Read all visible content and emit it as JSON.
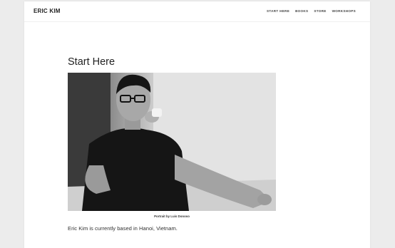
{
  "header": {
    "logo": "ERIC KIM",
    "nav": [
      {
        "label": "START HERE"
      },
      {
        "label": "BOOKS"
      },
      {
        "label": "STORE"
      },
      {
        "label": "WORKSHOPS"
      }
    ]
  },
  "main": {
    "title": "Start Here",
    "image_caption": "Portrait by Luis Donoso",
    "intro": "Eric Kim is currently based in Hanoi, Vietnam."
  },
  "colors": {
    "background": "#ececec",
    "page": "#ffffff",
    "text": "#222222"
  }
}
